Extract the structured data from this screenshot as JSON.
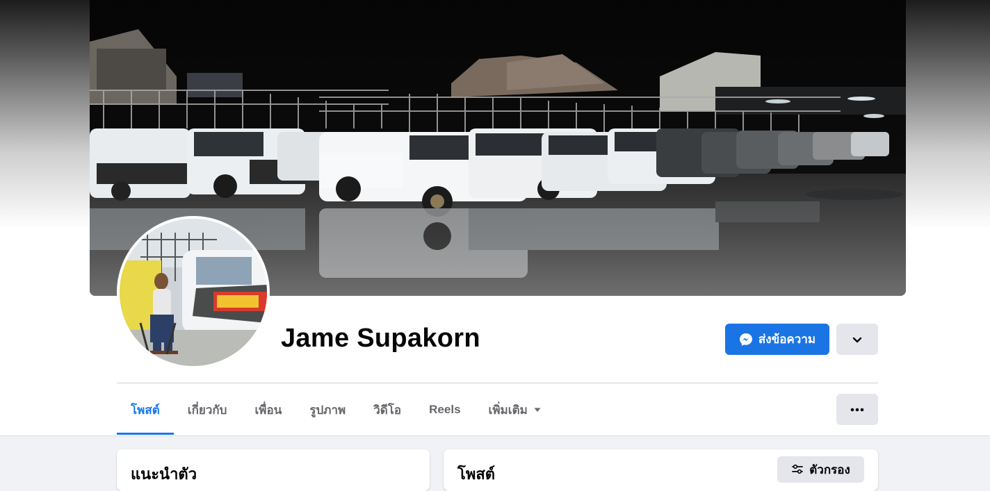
{
  "profile": {
    "name": "Jame Supakorn"
  },
  "actions": {
    "message_label": "ส่งข้อความ"
  },
  "tabs": [
    {
      "label": "โพสต์",
      "active": true
    },
    {
      "label": "เกี่ยวกับ",
      "active": false
    },
    {
      "label": "เพื่อน",
      "active": false
    },
    {
      "label": "รูปภาพ",
      "active": false
    },
    {
      "label": "วิดีโอ",
      "active": false
    },
    {
      "label": "Reels",
      "active": false
    },
    {
      "label": "เพิ่มเติม",
      "active": false
    }
  ],
  "intro_card": {
    "title": "แนะนำตัว"
  },
  "posts_card": {
    "title": "โพสต์",
    "filter_label": "ตัวกรอง"
  },
  "colors": {
    "accent": "#1877f2",
    "message_button": "#1b74e4",
    "secondary_button": "#e4e6eb",
    "page_background": "#f0f2f5"
  },
  "icons": {
    "message_button_icon": "messenger-icon",
    "chevron_button_icon": "chevron-down-icon",
    "more_tab_icon": "caret-down-icon",
    "more_options_icon": "more-dots-icon",
    "filter_icon": "sliders-icon"
  }
}
